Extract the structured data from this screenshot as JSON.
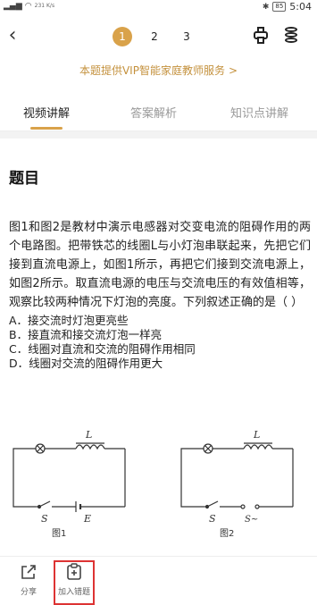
{
  "status": {
    "network": "4G",
    "network_speed": "231 K/s",
    "battery": "85",
    "time": "5:04"
  },
  "nav": {
    "pages": [
      "1",
      "2",
      "3"
    ],
    "active_page": "1"
  },
  "banner": {
    "text": "本题提供VIP智能家庭教师服务",
    "arrow": ">"
  },
  "tabs": [
    {
      "label": "视频讲解",
      "active": true
    },
    {
      "label": "答案解析",
      "active": false
    },
    {
      "label": "知识点讲解",
      "active": false
    }
  ],
  "content": {
    "title": "题目",
    "question": "图1和图2是教材中演示电感器对交变电流的阻碍作用的两个电路图。把带铁芯的线圈L与小灯泡串联起来，先把它们接到直流电源上，如图1所示，再把它们接到交流电源上，如图2所示。取直流电源的电压与交流电压的有效值相等，观察比较两种情况下灯泡的亮度。下列叙述正确的是（ ）",
    "options": [
      "A．接交流时灯泡更亮些",
      "B．接直流和接交流灯泡一样亮",
      "C．线圈对直流和交流的阻碍作用相同",
      "D．线圈对交流的阻碍作用更大"
    ]
  },
  "diagrams": {
    "fig1": {
      "inductor": "L",
      "switch": "S",
      "source": "E",
      "caption": "图1"
    },
    "fig2": {
      "inductor": "L",
      "switch": "S",
      "source": "S~",
      "caption": "图2"
    }
  },
  "bottom": {
    "share": "分享",
    "add_wrong": "加入错题"
  },
  "colors": {
    "accent": "#d9a24a",
    "banner": "#c4913d",
    "highlight_box": "#dd3333"
  }
}
